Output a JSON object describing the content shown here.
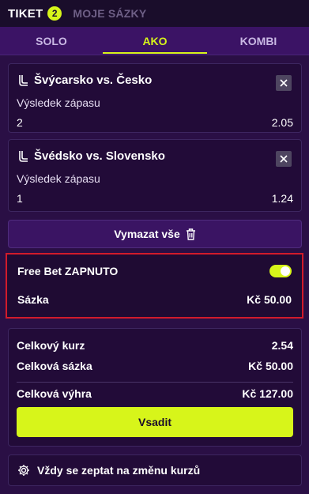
{
  "header": {
    "ticket_label": "TIKET",
    "ticket_count": "2",
    "my_bets_label": "MOJE SÁZKY"
  },
  "subtabs": {
    "solo": "SOLO",
    "ako": "AKO",
    "kombi": "KOMBI",
    "active": "AKO"
  },
  "bets": [
    {
      "match": "Švýcarsko vs. Česko",
      "market": "Výsledek zápasu",
      "pick": "2",
      "odd": "2.05"
    },
    {
      "match": "Švédsko vs. Slovensko",
      "market": "Výsledek zápasu",
      "pick": "1",
      "odd": "1.24"
    }
  ],
  "clear_all_label": "Vymazat vše",
  "free_bet": {
    "label": "Free Bet ZAPNUTO",
    "enabled": true,
    "stake_label": "Sázka",
    "stake_value": "Kč 50.00"
  },
  "summary": {
    "total_odds_label": "Celkový kurz",
    "total_odds_value": "2.54",
    "total_stake_label": "Celková sázka",
    "total_stake_value": "Kč 50.00",
    "total_win_label": "Celková výhra",
    "total_win_value": "Kč 127.00",
    "place_bet_label": "Vsadit"
  },
  "odds_change_label": "Vždy se zeptat na změnu kurzů",
  "colors": {
    "accent": "#d7f51a",
    "background": "#2a0f45",
    "card": "#220b38",
    "highlight_border": "#d11b2b"
  },
  "icons": {
    "sport": "hockey-stick-icon",
    "remove": "close-icon",
    "clear": "trash-icon",
    "settings": "gear-icon"
  }
}
